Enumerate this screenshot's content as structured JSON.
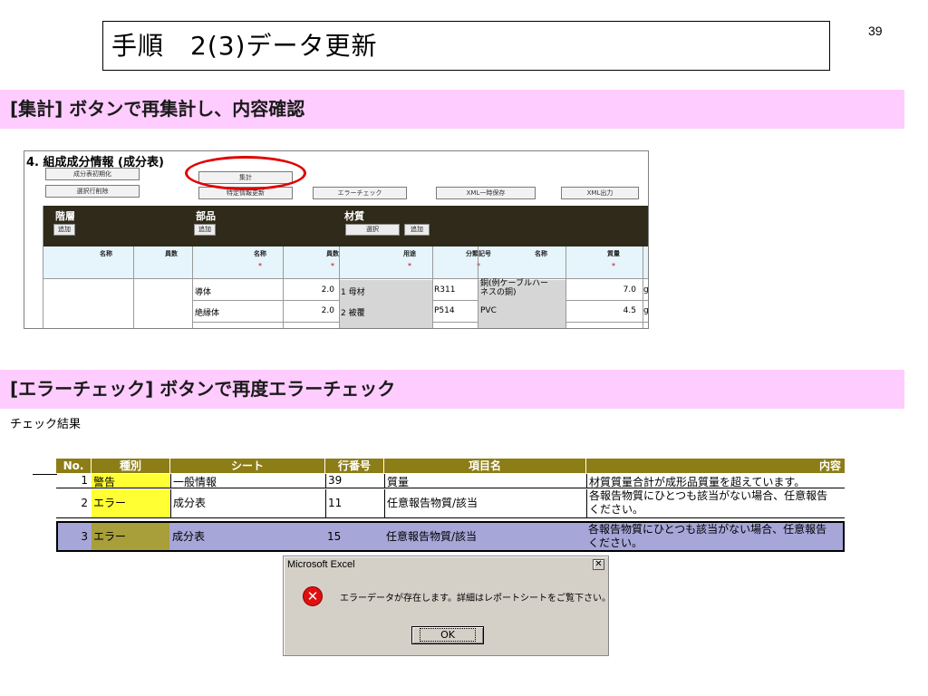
{
  "slide_number": "39",
  "title": "手順　2(3)データ更新",
  "section1": "[集計] ボタンで再集計し、内容確認",
  "section2": "[エラーチェック] ボタンで再度エラーチェック",
  "composition": {
    "heading": "4. 組成成分情報 (成分表)",
    "buttons": {
      "init": "成分表初期化",
      "delete_rows": "選択行削除",
      "aggregate": "集計",
      "update": "特定情報更新",
      "error_check": "エラーチェック",
      "xml_temp_save": "XML一時保存",
      "xml_output": "XML出力"
    },
    "groups": {
      "hierarchy": "階層",
      "part": "部品",
      "material": "材質"
    },
    "group_buttons": {
      "add": "追加",
      "select": "選択"
    },
    "columns": {
      "name": "名称",
      "count": "員数",
      "part_name": "名称",
      "part_count": "員数",
      "usage": "用途",
      "class_code": "分類記号",
      "material_name": "名称",
      "mass": "質量"
    },
    "required_mark": "*",
    "rows": [
      {
        "part": "導体",
        "count": "2.0",
        "usage": "1 母材",
        "code": "R311",
        "material": "銅(例ケーブルハーネスの銅)",
        "material_l1": "銅(例ケーブルハー",
        "material_l2": "ネスの銅)",
        "mass": "7.0",
        "unit": "g"
      },
      {
        "part": "絶縁体",
        "count": "2.0",
        "usage": "2 被覆",
        "code": "P514",
        "material": "PVC",
        "mass": "4.5",
        "unit": "g"
      }
    ]
  },
  "check_result": {
    "label": "チェック結果",
    "headers": [
      "No.",
      "種別",
      "シート",
      "行番号",
      "項目名",
      "内容"
    ],
    "rows": [
      {
        "no": "1",
        "type": "警告",
        "sheet": "一般情報",
        "line": "39",
        "item": "質量",
        "content": "材質質量合計が成形品質量を超えています。",
        "content2": ""
      },
      {
        "no": "2",
        "type": "エラー",
        "sheet": "成分表",
        "line": "11",
        "item": "任意報告物質/該当",
        "content": "各報告物質にひとつも該当がない場合、任意報告",
        "content2": "ください。"
      },
      {
        "no": "3",
        "type": "エラー",
        "sheet": "成分表",
        "line": "15",
        "item": "任意報告物質/該当",
        "content": "各報告物質にひとつも該当がない場合、任意報告",
        "content2": "ください。"
      }
    ]
  },
  "dialog": {
    "title": "Microsoft Excel",
    "message": "エラーデータが存在します。詳細はレポートシートをご覧下さい。",
    "ok": "OK",
    "close": "✕",
    "icon": "error-icon"
  },
  "colors": {
    "band": "#ffccff",
    "header_olive": "#8c7d16",
    "warn_yellow": "#ffff33",
    "error_olive": "#a89e3a",
    "highlight_row": "#a6a6d9",
    "ellipse": "#e00000"
  }
}
